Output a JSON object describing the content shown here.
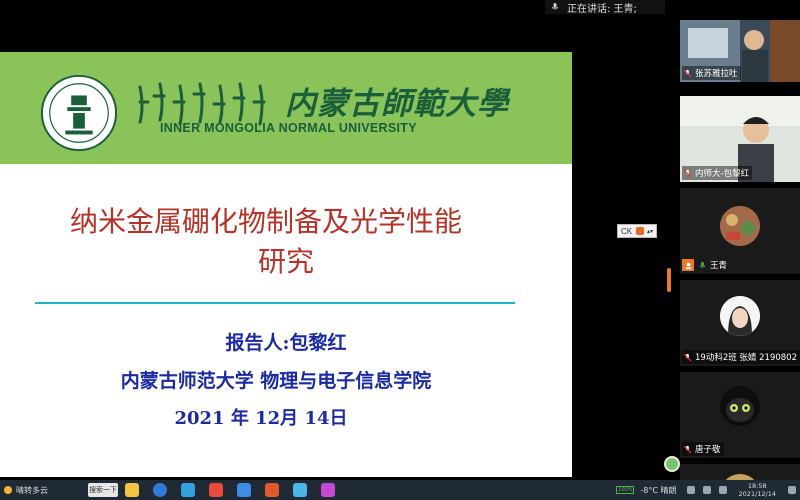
{
  "speaking": {
    "label": "正在讲话: 王青;"
  },
  "slide": {
    "university_cn": "内蒙古師範大學",
    "university_en": "INNER MONGOLIA NORMAL UNIVERSITY",
    "title_line1": "纳米金属硼化物制备及光学性能",
    "title_line2": "研究",
    "reporter": "报告人:包黎红",
    "affiliation": "内蒙古师范大学 物理与电子信息学院",
    "date": "2021 年 12月 14日"
  },
  "zoom": {
    "label": "CK"
  },
  "participants": [
    {
      "name": "张苏雅拉吐"
    },
    {
      "name": "内师大-包黎红"
    },
    {
      "name": "王青"
    },
    {
      "name": "19动科2班 张婧 2190802"
    },
    {
      "name": "唐子敬"
    }
  ],
  "taskbar": {
    "weather": "晴转多云",
    "search": "搜索一下",
    "battery": "100%",
    "temperature": "-8°C 晴朗",
    "time": "18:58",
    "date": "2021/12/14"
  },
  "colors": {
    "banner": "#8ac35a",
    "title": "#b5342a",
    "body_text": "#1b2aa3",
    "divider": "#22b3c9"
  }
}
